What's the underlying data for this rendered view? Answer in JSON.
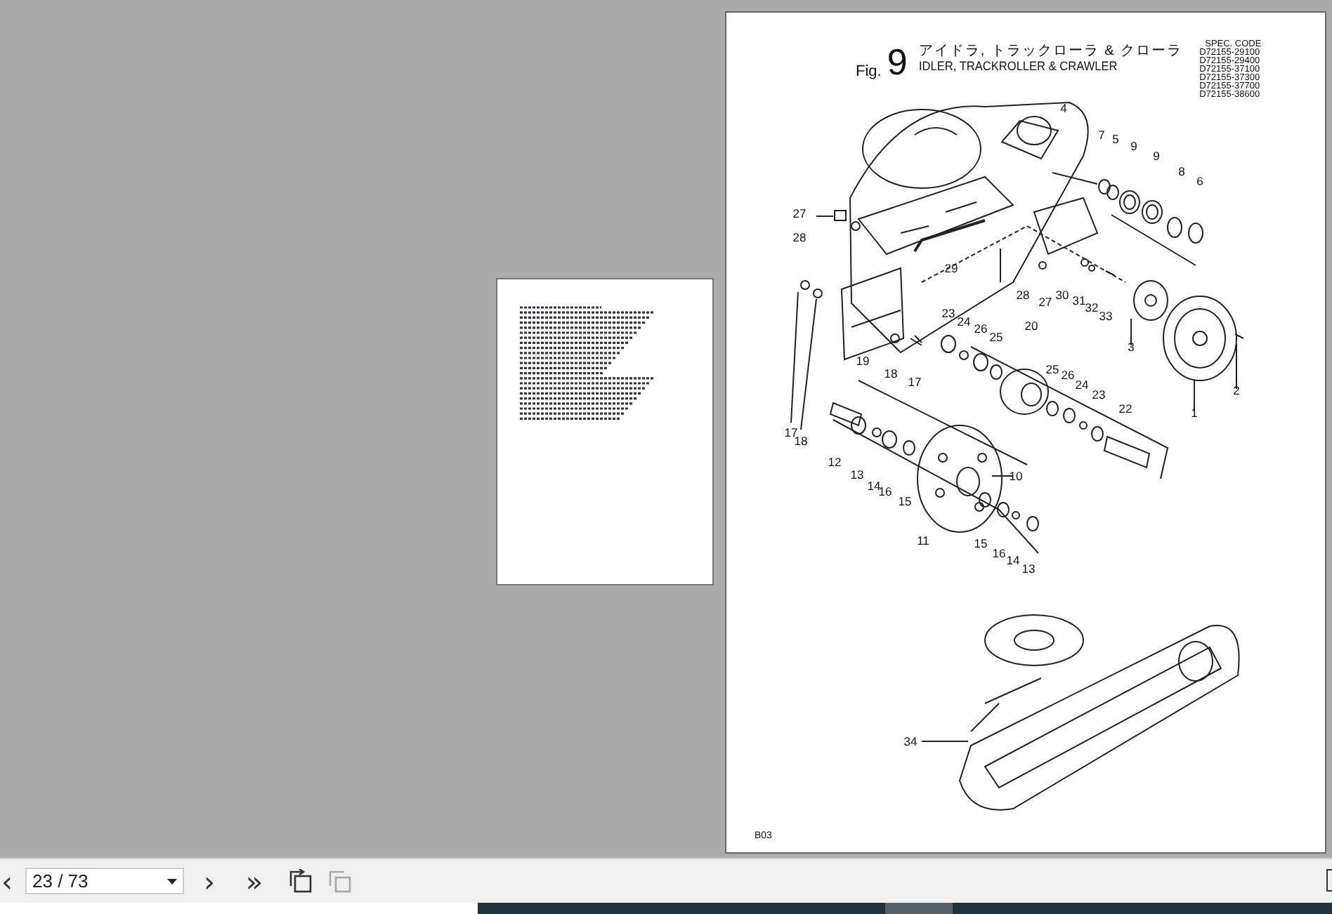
{
  "thumbnail": {
    "selected": false
  },
  "page": {
    "fig_label": "Fig.",
    "fig_number": "9",
    "title_ja": "アイドラ, トラックローラ & クローラ",
    "title_en": "IDLER, TRACKROLLER & CRAWLER",
    "spec_code": [
      "SPEC. CODE",
      "D72155-29100",
      "D72155-29400",
      "D72155-37100",
      "D72155-37300",
      "D72155-37700",
      "D72155-38600"
    ],
    "callouts": [
      "4",
      "7",
      "5",
      "9",
      "9",
      "8",
      "6",
      "27",
      "28",
      "29",
      "28",
      "27",
      "30",
      "31",
      "32",
      "33",
      "3",
      "2",
      "1",
      "23",
      "24",
      "26",
      "25",
      "20",
      "25",
      "26",
      "24",
      "23",
      "22",
      "19",
      "18",
      "17",
      "17",
      "18",
      "12",
      "13",
      "14",
      "16",
      "15",
      "10",
      "11",
      "15",
      "16",
      "14",
      "13",
      "34"
    ],
    "footer": "B03"
  },
  "toolbar": {
    "first": "‹",
    "page_field": "23 / 73",
    "next": "›",
    "last": "»"
  }
}
